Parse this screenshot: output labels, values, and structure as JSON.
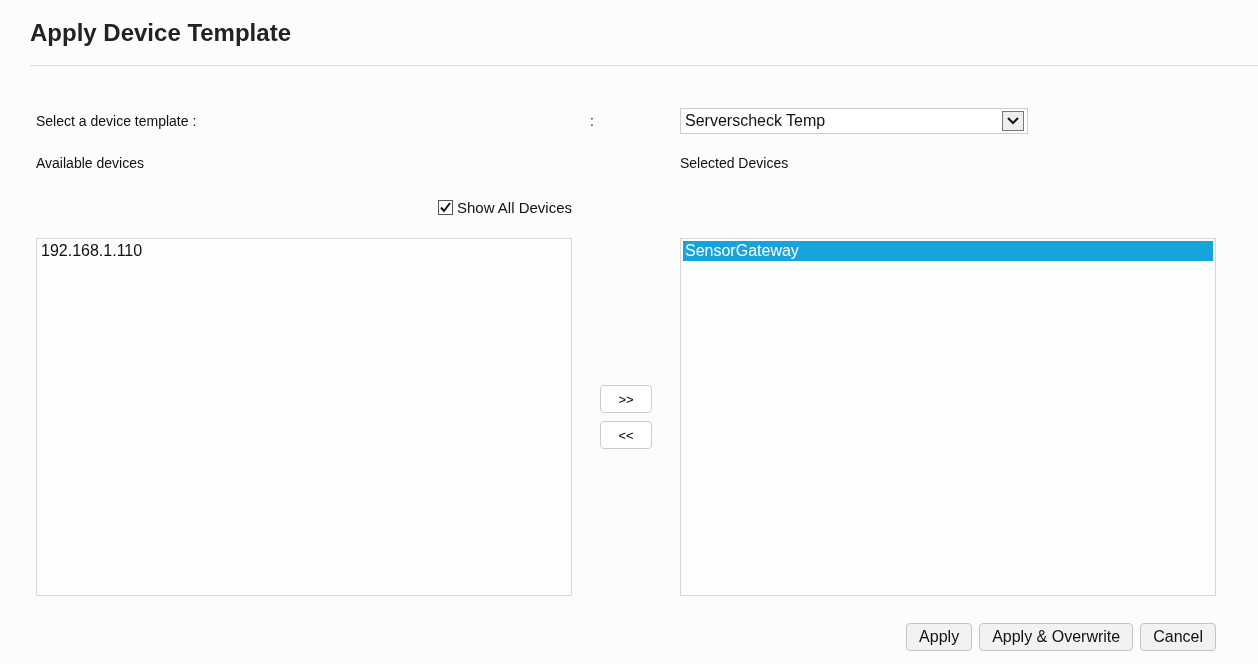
{
  "title": "Apply Device Template",
  "template_label": "Select a device template :",
  "separator": ":",
  "template_select": {
    "value": "Serverscheck Temp"
  },
  "available_label": "Available devices",
  "selected_label": "Selected Devices",
  "show_all": {
    "label": "Show All Devices",
    "checked": true
  },
  "available_devices": [
    {
      "name": "192.168.1.110",
      "selected": false
    }
  ],
  "selected_devices": [
    {
      "name": "SensorGateway",
      "selected": true
    }
  ],
  "move_buttons": [
    ">>",
    "<<"
  ],
  "buttons": [
    "Apply",
    "Apply & Overwrite",
    "Cancel"
  ]
}
